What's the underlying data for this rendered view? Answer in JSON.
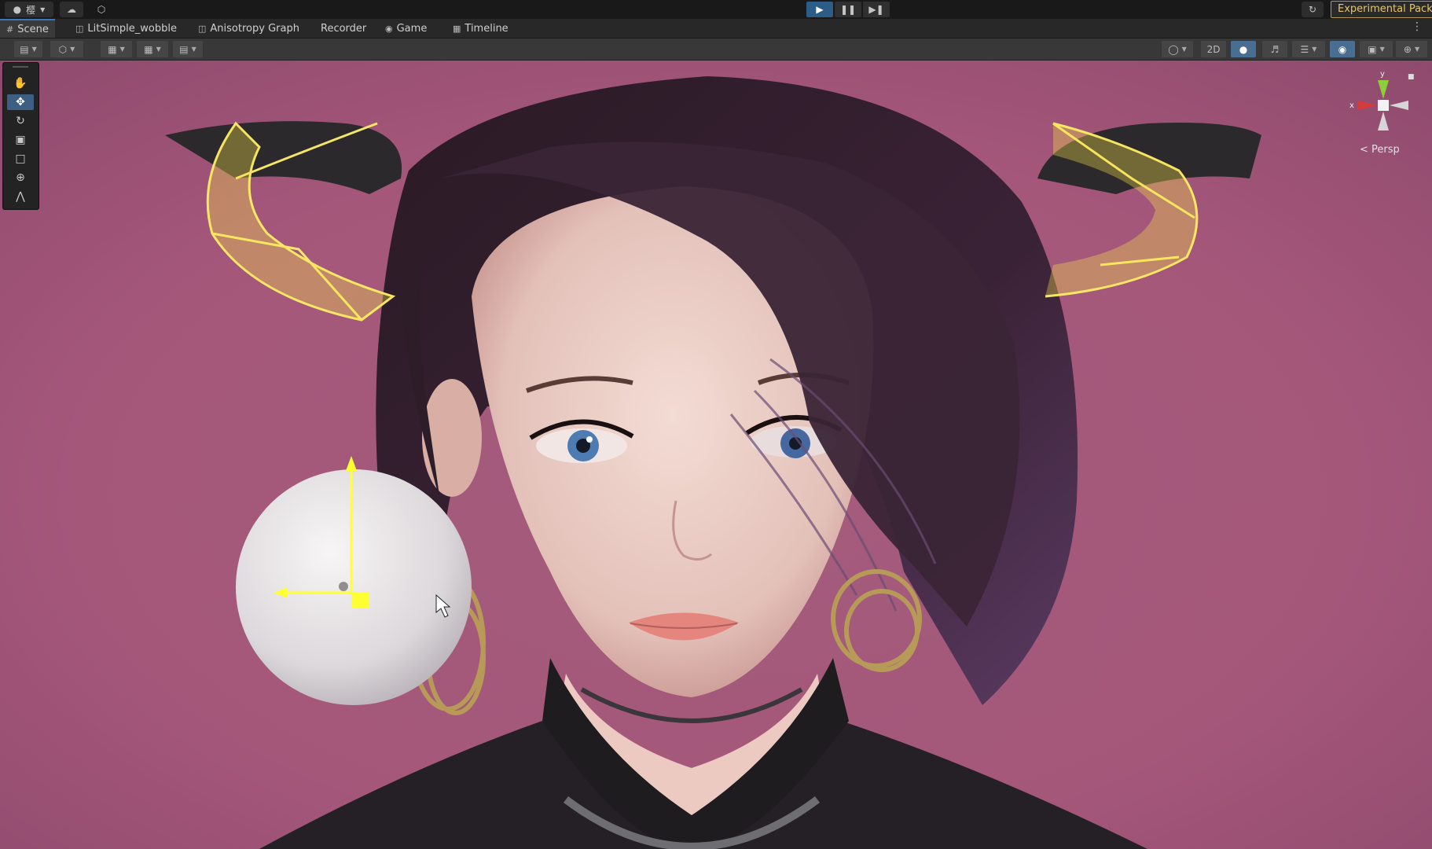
{
  "topbar": {
    "account_glyph": "樱",
    "experimental_label": "Experimental Packa"
  },
  "tabs": [
    {
      "label": "Scene",
      "icon": "scene-icon"
    },
    {
      "label": "LitSimple_wobble",
      "icon": "shader-graph-icon"
    },
    {
      "label": "Anisotropy Graph",
      "icon": "shader-graph-icon"
    },
    {
      "label": "Recorder",
      "icon": ""
    },
    {
      "label": "Game",
      "icon": "gamepad-icon"
    },
    {
      "label": "Timeline",
      "icon": "timeline-icon"
    }
  ],
  "scene_toolbar": {
    "mode_2d_label": "2D"
  },
  "gizmo": {
    "y_label": "y",
    "x_label": "x",
    "projection_label": "Persp"
  },
  "colors": {
    "accent": "#3a79bb",
    "play_active": "#2c5d87",
    "experimental_border": "#b59a55",
    "scene_bg": "#a5577a",
    "hover_yellow": "#ffff33"
  }
}
